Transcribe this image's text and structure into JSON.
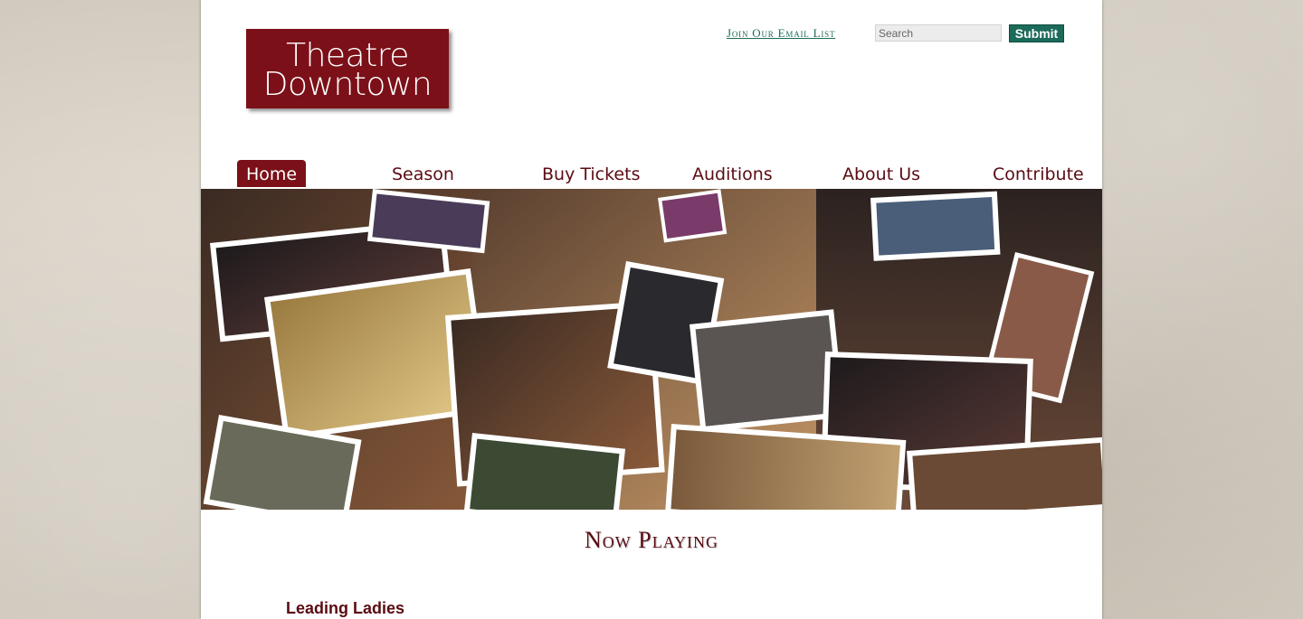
{
  "logo": {
    "line1": "Theatre",
    "line2": "Downtown"
  },
  "header": {
    "email_link": "Join Our Email List",
    "search_placeholder": "Search",
    "submit_label": "Submit"
  },
  "nav": {
    "items": [
      {
        "label": "Home",
        "active": true
      },
      {
        "label": "Season"
      },
      {
        "label": "Buy Tickets"
      },
      {
        "label": "Auditions"
      },
      {
        "label": "About Us"
      },
      {
        "label": "Contribute"
      }
    ]
  },
  "banner": {
    "description_icon": "photo-collage"
  },
  "main": {
    "section_title": "Now Playing",
    "show_title": "Leading Ladies"
  },
  "colors": {
    "brand": "#7b1018",
    "link": "#1f6b57",
    "submit": "#1c6a5a"
  }
}
